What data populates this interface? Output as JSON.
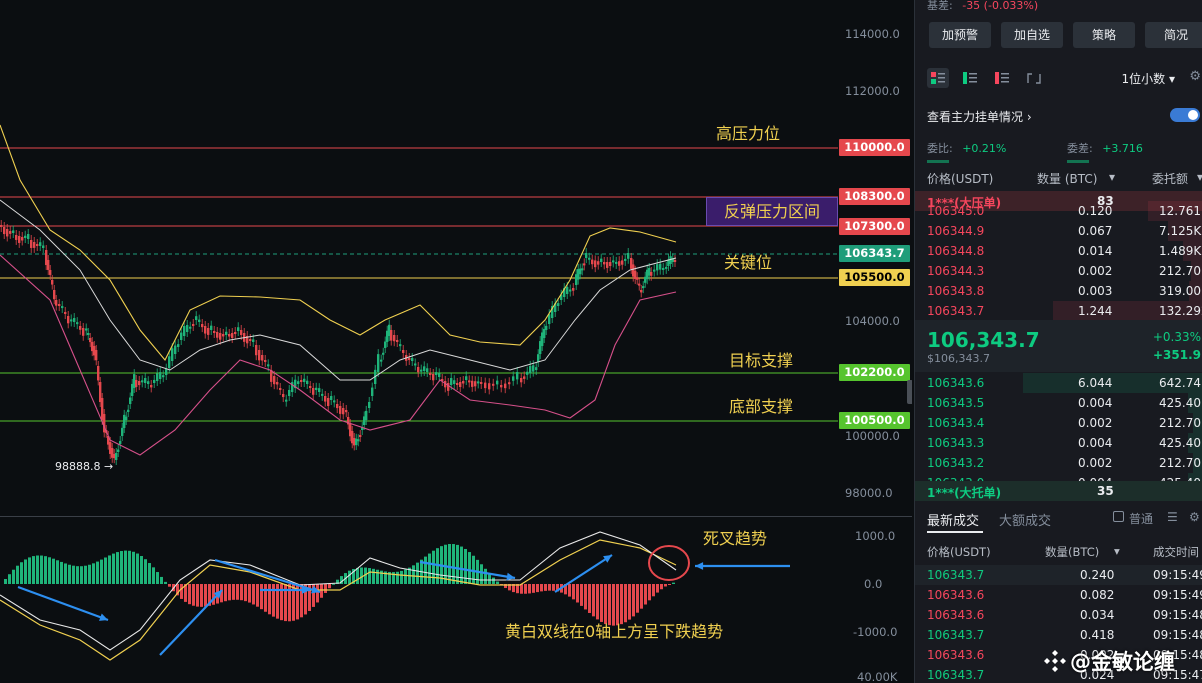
{
  "chart": {
    "y_axis_labels": [
      "114000.0",
      "112000.0",
      "104000.0",
      "100000.0",
      "98000.0"
    ],
    "macd_axis_labels": [
      "1000.0",
      "0.0",
      "-1000.0",
      "40.00K"
    ],
    "price_levels": [
      {
        "label": "高压力位",
        "price": "110000.0",
        "color": "#e5484d"
      },
      {
        "label": "反弹压力区间",
        "price": "108300.0",
        "color": "#e5484d"
      },
      {
        "label": "",
        "price": "107300.0",
        "color": "#e5484d"
      },
      {
        "label": "",
        "price": "106343.7",
        "color": "#1f9d7a"
      },
      {
        "label": "关键位",
        "price": "105500.0",
        "color": "#f0d050"
      },
      {
        "label": "目标支撑",
        "price": "102200.0",
        "color": "#56c42e"
      },
      {
        "label": "底部支撑",
        "price": "100500.0",
        "color": "#56c42e"
      }
    ],
    "low_marker": "98888.8 →",
    "annotations": {
      "death_cross": "死叉趋势",
      "macd_note": "黄白双线在0轴上方呈下跌趋势"
    }
  },
  "panel": {
    "sub_label": "基差:",
    "sub_value": "-35 (-0.033%)",
    "buttons": [
      "加预警",
      "加自选",
      "策略",
      "简况"
    ],
    "unit_select": "1位小数",
    "main_order_label": "查看主力挂单情况",
    "ratio": {
      "wb_label": "委比:",
      "wb_value": "+0.21%",
      "wc_label": "委差:",
      "wc_value": "+3.716"
    },
    "orderbook_headers": {
      "price": "价格(USDT)",
      "qty": "数量 (BTC)",
      "total": "委托额"
    },
    "big_ask": {
      "label": "1***(大压单)",
      "value": "83"
    },
    "asks": [
      {
        "price": "106345.0",
        "qty": "0.120",
        "total": "12.761K"
      },
      {
        "price": "106344.9",
        "qty": "0.067",
        "total": "7.125K"
      },
      {
        "price": "106344.8",
        "qty": "0.014",
        "total": "1.489K"
      },
      {
        "price": "106344.3",
        "qty": "0.002",
        "total": "212.70"
      },
      {
        "price": "106343.8",
        "qty": "0.003",
        "total": "319.00"
      },
      {
        "price": "106343.7",
        "qty": "1.244",
        "total": "132.292K"
      }
    ],
    "mid": {
      "price": "106,343.7",
      "sub": "$106,343.7",
      "pct": "+0.33%",
      "chg": "+351.9"
    },
    "bids": [
      {
        "price": "106343.6",
        "qty": "6.044",
        "total": "642.741K"
      },
      {
        "price": "106343.5",
        "qty": "0.004",
        "total": "425.40"
      },
      {
        "price": "106343.4",
        "qty": "0.002",
        "total": "212.70"
      },
      {
        "price": "106343.3",
        "qty": "0.004",
        "total": "425.40"
      },
      {
        "price": "106343.2",
        "qty": "0.002",
        "total": "212.70"
      },
      {
        "price": "106343.0",
        "qty": "0.004",
        "total": "425.40"
      }
    ],
    "big_bid": {
      "label": "1***(大托单)",
      "value": "35"
    },
    "trade_tabs": [
      "最新成交",
      "大额成交"
    ],
    "trade_option": "普通",
    "trade_headers": {
      "price": "价格(USDT)",
      "qty": "数量(BTC)",
      "time": "成交时间"
    },
    "trades": [
      {
        "price": "106343.7",
        "qty": "0.240",
        "time": "09:15:49",
        "side": "buy"
      },
      {
        "price": "106343.6",
        "qty": "0.082",
        "time": "09:15:49",
        "side": "sell"
      },
      {
        "price": "106343.6",
        "qty": "0.034",
        "time": "09:15:48",
        "side": "sell"
      },
      {
        "price": "106343.7",
        "qty": "0.418",
        "time": "09:15:48",
        "side": "buy"
      },
      {
        "price": "106343.6",
        "qty": "0.002",
        "time": "09:15:48",
        "side": "sell"
      },
      {
        "price": "106343.7",
        "qty": "0.024",
        "time": "09:15:47",
        "side": "buy"
      }
    ],
    "watermark": "@金敏论缠"
  }
}
